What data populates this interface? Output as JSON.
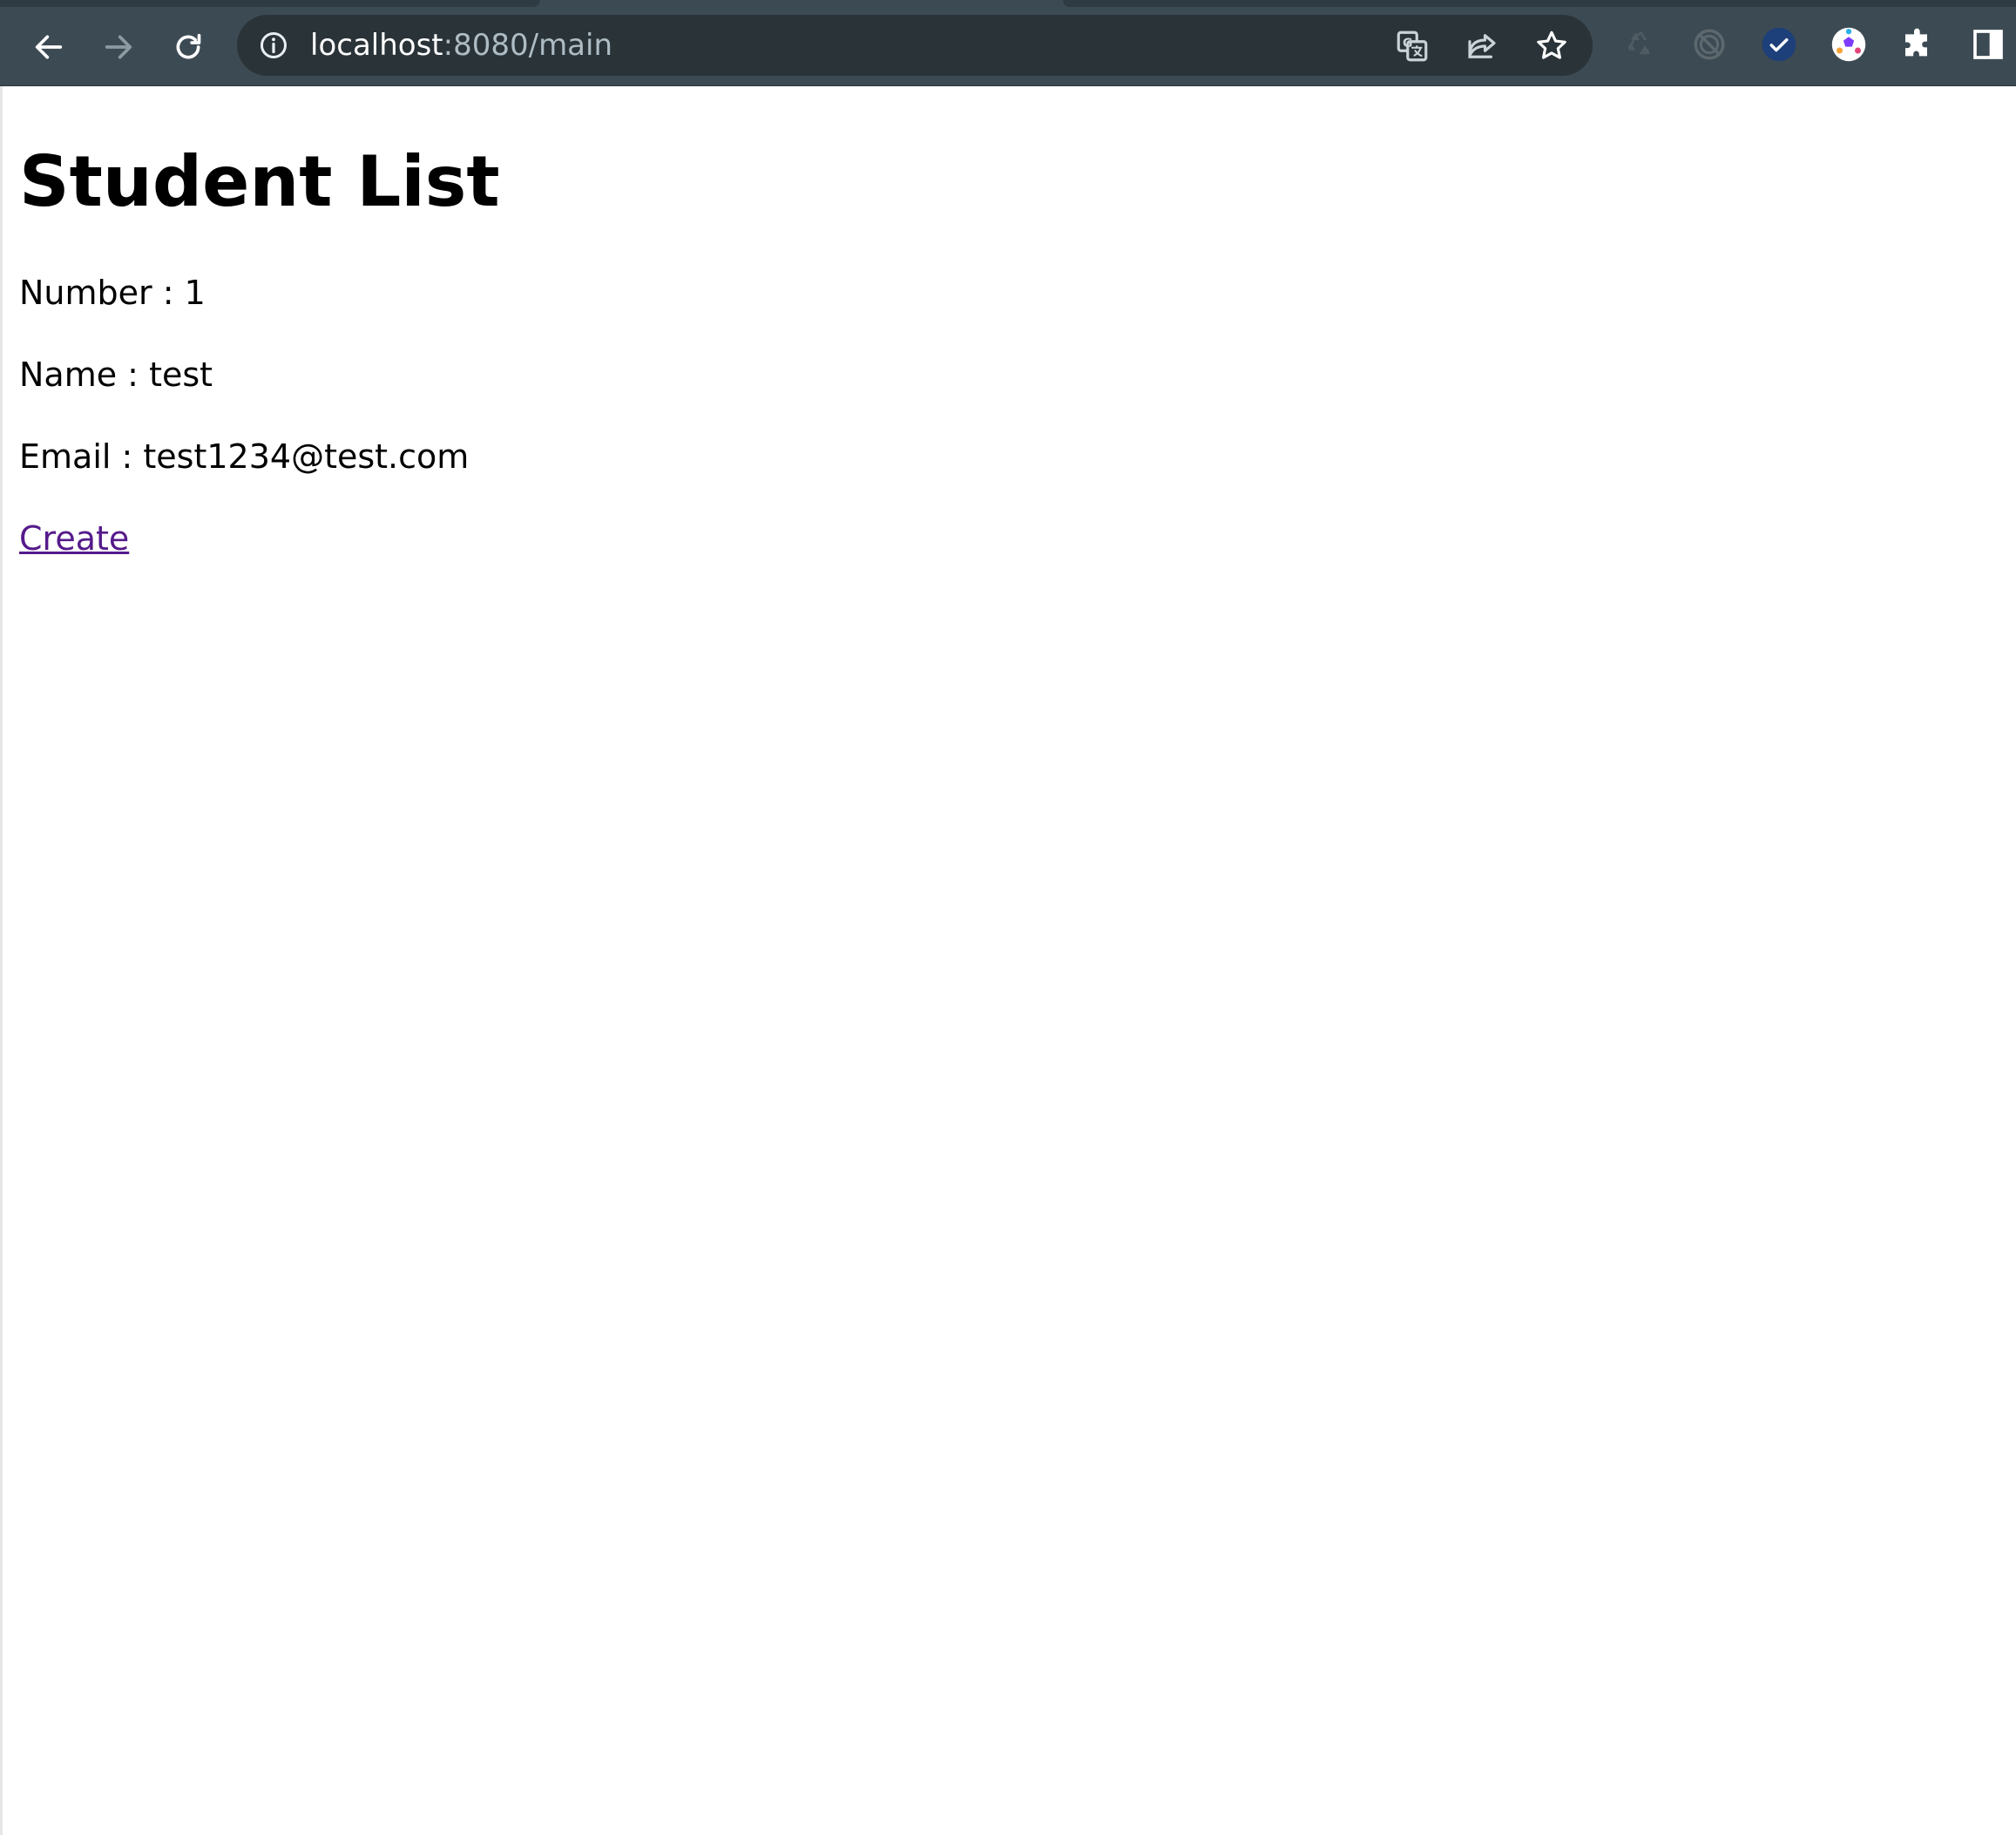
{
  "browser": {
    "url_host": "localhost",
    "url_rest": ":8080/main",
    "icons": {
      "back": "back-arrow-icon",
      "forward": "forward-arrow-icon",
      "reload": "reload-icon",
      "info": "info-icon",
      "translate": "translate-icon",
      "share": "share-icon",
      "bookmark": "star-icon",
      "extensions": [
        "recycle-icon",
        "radar-icon",
        "check-circle-icon",
        "soccer-ball-icon",
        "puzzle-icon",
        "side-panel-icon"
      ]
    },
    "colors": {
      "toolbar": "#3c4a53",
      "omnibox": "#293338",
      "check_badge": "#1d3f7a"
    }
  },
  "page": {
    "title": "Student List",
    "number_line": "Number : 1",
    "name_line": "Name : test",
    "email_line": "Email : test1234@test.com",
    "create_link": "Create",
    "link_color": "#551a8b"
  }
}
